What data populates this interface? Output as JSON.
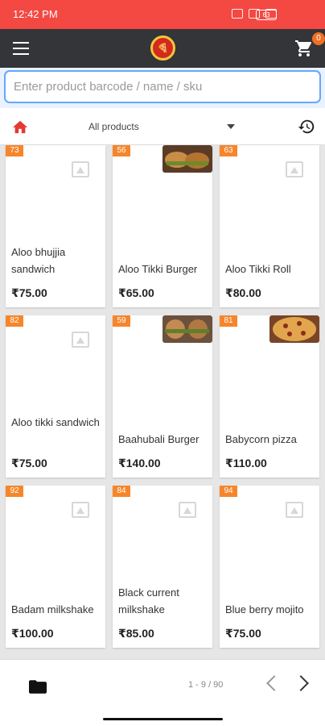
{
  "status": {
    "time": "12:42 PM",
    "battery": "63"
  },
  "header": {
    "cart_count": "0",
    "logo_text": "🍕"
  },
  "search": {
    "placeholder": "Enter product barcode / name / sku"
  },
  "filter": {
    "selected": "All products"
  },
  "products": [
    {
      "id": "73",
      "name": "Aloo bhujjia sandwich",
      "price": "₹75.00",
      "image": "placeholder"
    },
    {
      "id": "56",
      "name": "Aloo Tikki Burger",
      "price": "₹65.00",
      "image": "burger-photo"
    },
    {
      "id": "63",
      "name": "Aloo Tikki Roll",
      "price": "₹80.00",
      "image": "placeholder"
    },
    {
      "id": "82",
      "name": "Aloo tikki sandwich",
      "price": "₹75.00",
      "image": "placeholder"
    },
    {
      "id": "59",
      "name": "Baahubali Burger",
      "price": "₹140.00",
      "image": "burger-photo"
    },
    {
      "id": "81",
      "name": "Babycorn pizza",
      "price": "₹110.00",
      "image": "pizza-photo"
    },
    {
      "id": "92",
      "name": "Badam milkshake",
      "price": "₹100.00",
      "image": "placeholder"
    },
    {
      "id": "84",
      "name": "Black current milkshake",
      "price": "₹85.00",
      "image": "placeholder"
    },
    {
      "id": "94",
      "name": "Blue berry mojito",
      "price": "₹75.00",
      "image": "placeholder"
    }
  ],
  "pagination": {
    "text": "1 - 9 / 90"
  },
  "colors": {
    "statusbar": "#f44842",
    "topbar": "#333538",
    "badge": "#f6862b",
    "accent": "#e53935"
  }
}
